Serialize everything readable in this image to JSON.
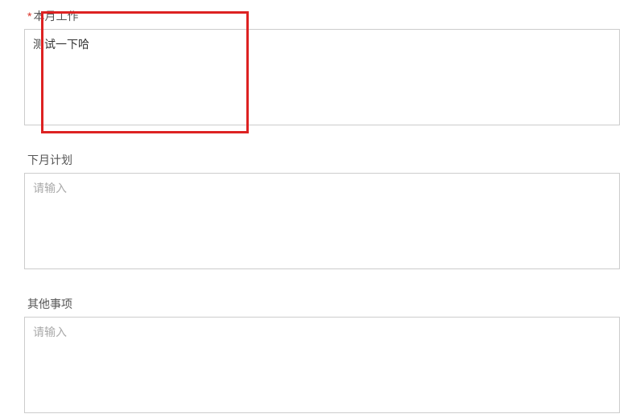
{
  "fields": {
    "this_month": {
      "required_mark": "*",
      "label": "本月工作",
      "value": "测试一下哈",
      "placeholder": ""
    },
    "next_month": {
      "label": "下月计划",
      "value": "",
      "placeholder": "请输入"
    },
    "other": {
      "label": "其他事项",
      "value": "",
      "placeholder": "请输入"
    }
  }
}
